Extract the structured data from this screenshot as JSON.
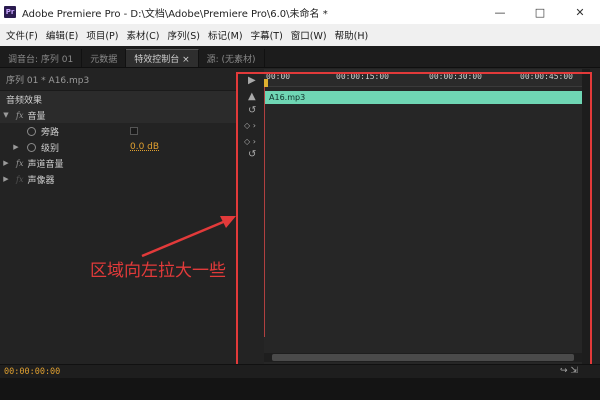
{
  "window": {
    "logo": "Pr",
    "title": "Adobe Premiere Pro - D:\\文档\\Adobe\\Premiere Pro\\6.0\\未命名 *",
    "controls": [
      "—",
      "□",
      "✕"
    ]
  },
  "menu": [
    "文件(F)",
    "编辑(E)",
    "项目(P)",
    "素材(C)",
    "序列(S)",
    "标记(M)",
    "字幕(T)",
    "窗口(W)",
    "帮助(H)"
  ],
  "tabs": [
    {
      "label": "调音台: 序列 01",
      "active": false
    },
    {
      "label": "元数据",
      "active": false
    },
    {
      "label": "特效控制台 ×",
      "active": true
    },
    {
      "label": "源: (无素材)",
      "active": false
    }
  ],
  "effect_controls": {
    "sequence_label": "序列 01 * A16.mp3",
    "section_title": "音频效果",
    "volume": {
      "label": "音量"
    },
    "bypass": {
      "label": "旁路"
    },
    "level": {
      "label": "级别",
      "value": "0.0 dB"
    },
    "channel_volume": {
      "label": "声道音量"
    },
    "panner": {
      "label": "声像器"
    }
  },
  "timeline": {
    "ticks": [
      "00:00",
      "00:00:15:00",
      "00:00:30:00",
      "00:00:45:00"
    ],
    "clip_label": "A16.mp3"
  },
  "annotation": {
    "text": "区域向左拉大一些",
    "color": "#e23a3a"
  },
  "status": {
    "timecode": "00:00:00:00"
  },
  "colors": {
    "clip": "#6fd6b4",
    "value": "#e0a030",
    "highlight": "#e23a3a"
  }
}
